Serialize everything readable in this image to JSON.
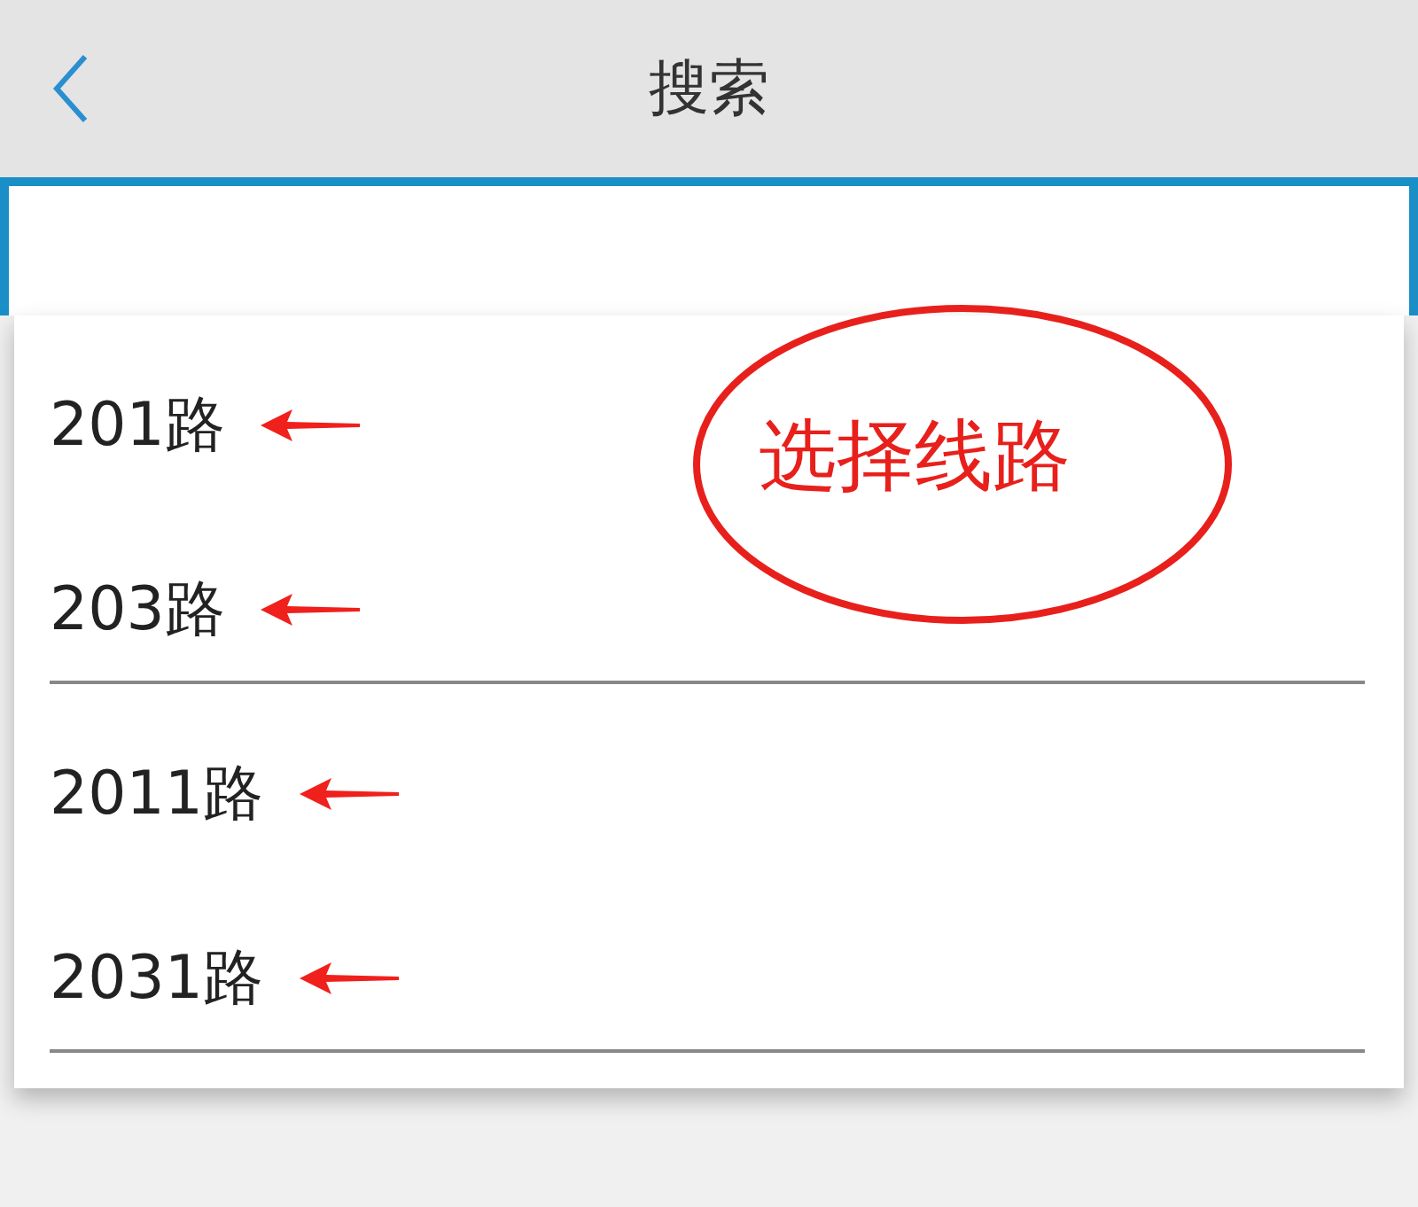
{
  "header": {
    "title": "搜索"
  },
  "routes": [
    {
      "label": "201路",
      "underlined": false
    },
    {
      "label": "203路",
      "underlined": true
    },
    {
      "label": "2011路",
      "underlined": false
    },
    {
      "label": "2031路",
      "underlined": true
    }
  ],
  "annotation": {
    "text": "选择线路"
  }
}
